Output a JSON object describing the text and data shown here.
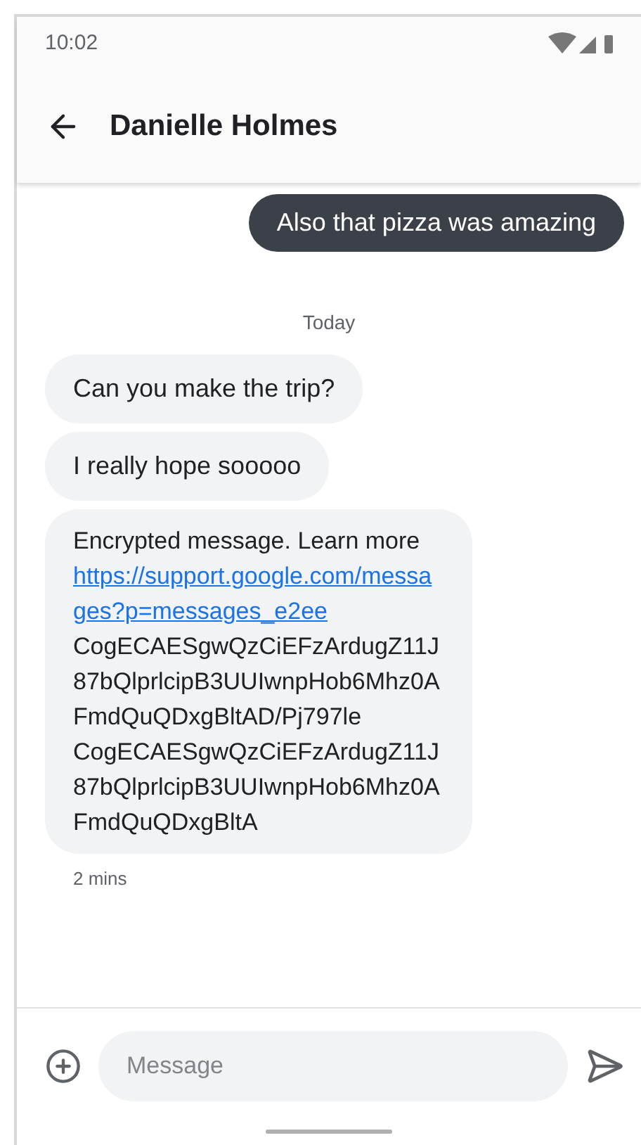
{
  "status_bar": {
    "time": "10:02"
  },
  "header": {
    "title": "Danielle Holmes"
  },
  "messages": [
    {
      "kind": "outgoing",
      "text": "Also that pizza was amazing"
    },
    {
      "kind": "date",
      "text": "Today"
    },
    {
      "kind": "incoming",
      "text": "Can you make the trip?"
    },
    {
      "kind": "incoming",
      "text": "I really hope sooooo"
    },
    {
      "kind": "encrypted",
      "text": "Encrypted message. Learn more",
      "link": "https://support.google.com/messages?p=messages_e2ee",
      "codes": [
        "CogECAESgwQzCiEFzArdugZ11J87bQlprlcipB3UUIwnpHob6Mhz0AFmdQuQDxgBltAD/Pj797le",
        "CogECAESgwQzCiEFzArdugZ11J87bQlprlcipB3UUIwnpHob6Mhz0AFmdQuQDxgBltA"
      ]
    },
    {
      "kind": "time",
      "text": "2 mins"
    }
  ],
  "composer": {
    "placeholder": "Message"
  }
}
